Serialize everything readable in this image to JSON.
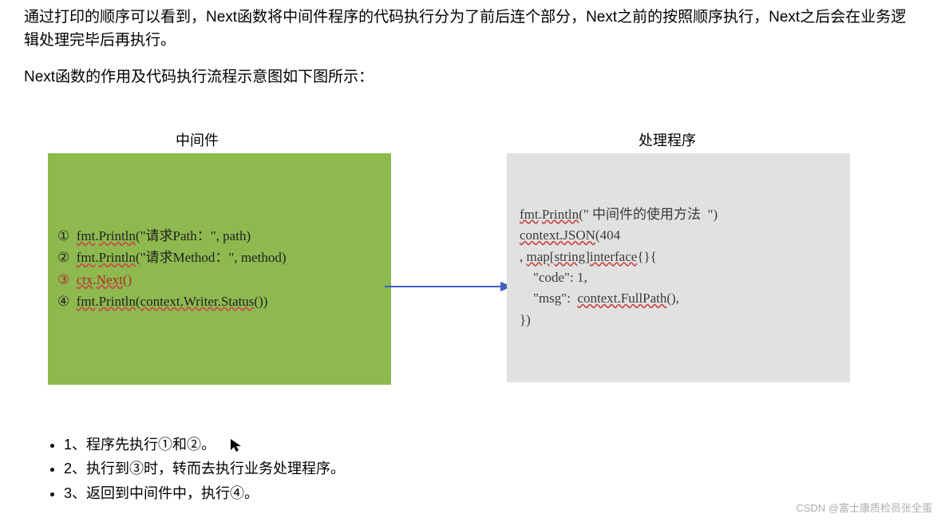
{
  "paragraphs": {
    "p1": "通过打印的顺序可以看到，Next函数将中间件程序的代码执行分为了前后连个部分，Next之前的按照顺序执行，Next之后会在业务逻辑处理完毕后再执行。",
    "p2": "Next函数的作用及代码执行流程示意图如下图所示："
  },
  "diagram": {
    "left_title": "中间件",
    "right_title": "处理程序",
    "left_lines": {
      "l1_num": "①  ",
      "l1_a": "fmt",
      "l1_b": ".",
      "l1_c": "Println",
      "l1_d": "(\"请求Path：\", path)",
      "l2_num": "②  ",
      "l2_a": "fmt",
      "l2_b": ".",
      "l2_c": "Println",
      "l2_d": "(\"请求Method：\", method)",
      "l3_num": "③  ",
      "l3_a": "ctx",
      "l3_b": ".",
      "l3_c": "Next",
      "l3_d": "()",
      "l4_num": "④  ",
      "l4_a": "fmt",
      "l4_b": ".",
      "l4_c": "Println",
      "l4_d": "(",
      "l4_e": "context.Writer.Status",
      "l4_f": "())"
    },
    "right_lines": {
      "r1_a": "fmt",
      "r1_b": ".",
      "r1_c": "Println",
      "r1_d": "(\" 中间件的使用方法  \")",
      "r2_a": "context.JSON",
      "r2_b": "(404",
      "r3_a": ", ",
      "r3_b": "map",
      "r3_c": "[",
      "r3_d": "string",
      "r3_e": "]",
      "r3_f": "interface",
      "r3_g": "{}{",
      "r4": "    \"code\": 1,",
      "r5_a": "    \"msg\":  ",
      "r5_b": "context.FullPath",
      "r5_c": "(),",
      "r6": "})"
    }
  },
  "steps": {
    "s1": "1、程序先执行①和②。",
    "s2": "2、执行到③时，转而去执行业务处理程序。",
    "s3": "3、返回到中间件中，执行④。"
  },
  "watermark": "CSDN @富士康质检员张全蛋"
}
